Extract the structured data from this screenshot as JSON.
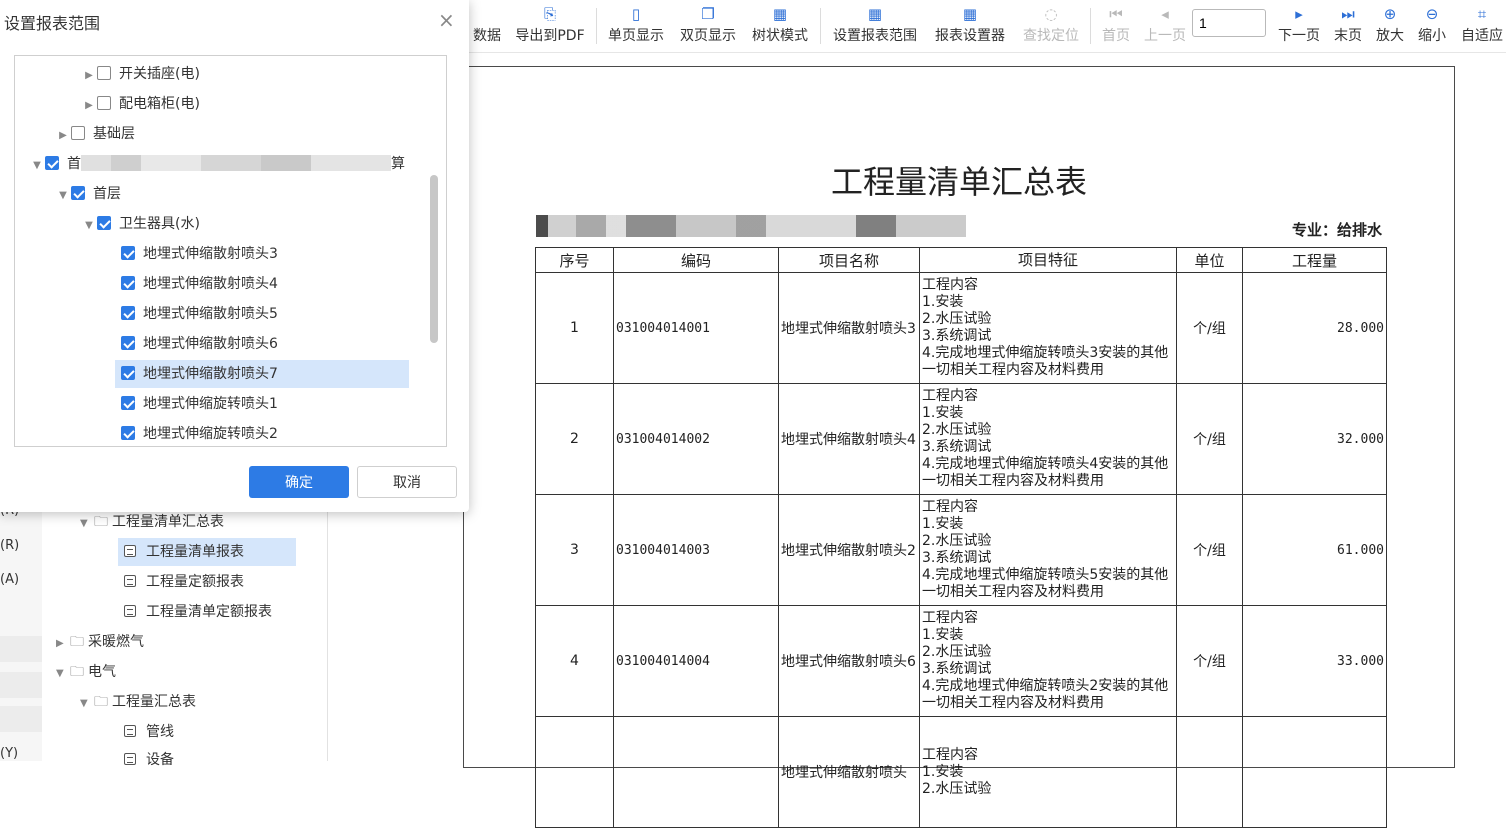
{
  "toolbar": {
    "partial_left": "数据",
    "export_pdf": "导出到PDF",
    "single_page": "单页显示",
    "double_page": "双页显示",
    "tree_mode": "树状模式",
    "set_range": "设置报表范围",
    "report_settings": "报表设置器",
    "find_locate": "查找定位",
    "first_page": "首页",
    "prev_page": "上一页",
    "page_value": "1",
    "next_page": "下一页",
    "last_page": "末页",
    "zoom_in": "放大",
    "zoom_out": "缩小",
    "fit": "自适应",
    "icons": {
      "export_pdf": "export-pdf-icon",
      "single_page": "single-page-icon",
      "double_page": "double-page-icon",
      "tree_mode": "tree-mode-icon",
      "set_range": "grid-range-icon",
      "report_settings": "report-settings-icon",
      "find_locate": "locate-icon",
      "first_page": "first-page-icon",
      "prev_page": "prev-page-icon",
      "next_page": "next-page-icon",
      "last_page": "last-page-icon",
      "zoom_in": "zoom-in-icon",
      "zoom_out": "zoom-out-icon",
      "fit": "fit-icon"
    }
  },
  "left_tree": {
    "edge_labels": [
      "(R)",
      "(R)",
      "(A)",
      "(Y)"
    ],
    "items": [
      {
        "label": "工程量清单汇总表"
      },
      {
        "label": "工程量清单报表"
      },
      {
        "label": "工程量定额报表"
      },
      {
        "label": "工程量清单定额报表"
      },
      {
        "label": "采暖燃气"
      },
      {
        "label": "电气"
      },
      {
        "label": "工程量汇总表"
      },
      {
        "label": "管线"
      },
      {
        "label": "设备"
      }
    ]
  },
  "dialog": {
    "title": "设置报表范围",
    "close_glyph": "×",
    "nodes": [
      {
        "label": "开关插座(电)",
        "checked": false
      },
      {
        "label": "配电箱柜(电)",
        "checked": false
      },
      {
        "label": "基础层",
        "checked": false
      },
      {
        "label_prefix": "首",
        "label_suffix": "算",
        "checked": true
      },
      {
        "label": "首层",
        "checked": true
      },
      {
        "label": "卫生器具(水)",
        "checked": true
      },
      {
        "label": "地埋式伸缩散射喷头3",
        "checked": true
      },
      {
        "label": "地埋式伸缩散射喷头4",
        "checked": true
      },
      {
        "label": "地埋式伸缩散射喷头5",
        "checked": true
      },
      {
        "label": "地埋式伸缩散射喷头6",
        "checked": true
      },
      {
        "label": "地埋式伸缩散射喷头7",
        "checked": true
      },
      {
        "label": "地埋式伸缩旋转喷头1",
        "checked": true
      },
      {
        "label": "地埋式伸缩旋转喷头2",
        "checked": true
      }
    ],
    "ok_label": "确定",
    "cancel_label": "取消",
    "accent": "#2d7be5"
  },
  "report": {
    "title": "工程量清单汇总表",
    "project_prefix": "工程",
    "major": "专业：给排水",
    "headers": [
      "序号",
      "编码",
      "项目名称",
      "项目特征",
      "单位",
      "工程量"
    ],
    "rows": [
      {
        "no": "1",
        "code": "031004014001",
        "name": "地埋式伸缩散射喷头3",
        "feature": [
          "工程内容",
          "1.安装",
          "2.水压试验",
          "3.系统调试",
          "4.完成地埋式伸缩旋转喷头3安装的其他一切相关工程内容及材料费用"
        ],
        "unit": "个/组",
        "qty": "28.000"
      },
      {
        "no": "2",
        "code": "031004014002",
        "name": "地埋式伸缩散射喷头4",
        "feature": [
          "工程内容",
          "1.安装",
          "2.水压试验",
          "3.系统调试",
          "4.完成地埋式伸缩旋转喷头4安装的其他一切相关工程内容及材料费用"
        ],
        "unit": "个/组",
        "qty": "32.000"
      },
      {
        "no": "3",
        "code": "031004014003",
        "name": "地埋式伸缩散射喷头2",
        "feature": [
          "工程内容",
          "1.安装",
          "2.水压试验",
          "3.系统调试",
          "4.完成地埋式伸缩旋转喷头5安装的其他一切相关工程内容及材料费用"
        ],
        "unit": "个/组",
        "qty": "61.000"
      },
      {
        "no": "4",
        "code": "031004014004",
        "name": "地埋式伸缩散射喷头6",
        "feature": [
          "工程内容",
          "1.安装",
          "2.水压试验",
          "3.系统调试",
          "4.完成地埋式伸缩旋转喷头2安装的其他一切相关工程内容及材料费用"
        ],
        "unit": "个/组",
        "qty": "33.000"
      },
      {
        "no": "",
        "code": "",
        "name": "地埋式伸缩散射喷头",
        "feature": [
          "工程内容",
          "1.安装",
          "2.水压试验"
        ],
        "unit": "",
        "qty": ""
      }
    ]
  }
}
